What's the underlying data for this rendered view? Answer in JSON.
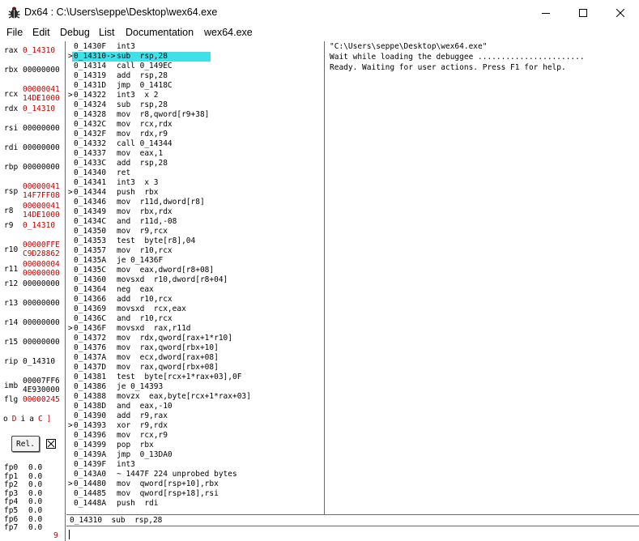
{
  "window": {
    "title": "Dx64 : C:\\Users\\seppe\\Desktop\\wex64.exe",
    "icons": [
      "bug-icon",
      "minimize-icon",
      "maximize-icon",
      "close-icon"
    ]
  },
  "menu": [
    "File",
    "Edit",
    "Debug",
    "List",
    "Documentation",
    "wex64.exe"
  ],
  "colors": {
    "changed": "#c00000",
    "highlight": "#40e0e8",
    "border": "#6a6a6a"
  },
  "registers": [
    {
      "name": "rax",
      "l1": "0_14310",
      "l2": "",
      "red": true
    },
    {
      "name": "rbx",
      "l1": "00000000",
      "l2": "",
      "red": false
    },
    {
      "name": "rcx",
      "l1": "00000041",
      "l2": "14DE1000",
      "red": true
    },
    {
      "name": "rdx",
      "l1": "0_14310",
      "l2": "",
      "red": true
    },
    {
      "name": "rsi",
      "l1": "00000000",
      "l2": "",
      "red": false
    },
    {
      "name": "rdi",
      "l1": "00000000",
      "l2": "",
      "red": false
    },
    {
      "name": "rbp",
      "l1": "00000000",
      "l2": "",
      "red": false
    },
    {
      "name": "rsp",
      "l1": "00000041",
      "l2": "14F7FF08",
      "red": true
    },
    {
      "name": "r8",
      "l1": "00000041",
      "l2": "14DE1000",
      "red": true
    },
    {
      "name": "r9",
      "l1": "0_14310",
      "l2": "",
      "red": true
    },
    {
      "name": "r10",
      "l1": "00000FFE",
      "l2": "C9D28862",
      "red": true
    },
    {
      "name": "r11",
      "l1": "00000004",
      "l2": "00000000",
      "red": true
    },
    {
      "name": "r12",
      "l1": "00000000",
      "l2": "",
      "red": false
    },
    {
      "name": "r13",
      "l1": "00000000",
      "l2": "",
      "red": false
    },
    {
      "name": "r14",
      "l1": "00000000",
      "l2": "",
      "red": false
    },
    {
      "name": "r15",
      "l1": "00000000",
      "l2": "",
      "red": false
    },
    {
      "name": "rip",
      "l1": "0_14310",
      "l2": "",
      "red": false
    },
    {
      "name": "imb",
      "l1": "00007FF6",
      "l2": "4E930000",
      "red": false
    },
    {
      "name": "flg",
      "l1": "00000245",
      "l2": "",
      "red": true
    }
  ],
  "flags": [
    {
      "t": "o",
      "red": false
    },
    {
      "t": "D",
      "red": true
    },
    {
      "t": "i",
      "red": false
    },
    {
      "t": "a",
      "red": false
    },
    {
      "t": "C",
      "red": true
    },
    {
      "t": "]",
      "red": true
    }
  ],
  "rel_button": "Rel.",
  "fpu": [
    {
      "name": "fp0",
      "val": "0.0"
    },
    {
      "name": "fp1",
      "val": "0.0"
    },
    {
      "name": "fp2",
      "val": "0.0"
    },
    {
      "name": "fp3",
      "val": "0.0"
    },
    {
      "name": "fp4",
      "val": "0.0"
    },
    {
      "name": "fp5",
      "val": "0.0"
    },
    {
      "name": "fp6",
      "val": "0.0"
    },
    {
      "name": "fp7",
      "val": "0.0"
    }
  ],
  "bottom_value": "9",
  "disassembly": [
    {
      "m": "",
      "a": "0_1430F",
      "i": "int3"
    },
    {
      "m": ">",
      "a": "0_14310->",
      "i": "sub  rsp,28",
      "current": true
    },
    {
      "m": "",
      "a": "0_14314",
      "i": "call 0_149EC"
    },
    {
      "m": "",
      "a": "0_14319",
      "i": "add  rsp,28"
    },
    {
      "m": "",
      "a": "0_1431D",
      "i": "jmp  0_1418C"
    },
    {
      "m": ">",
      "a": "0_14322",
      "i": "int3  x 2"
    },
    {
      "m": "",
      "a": "0_14324",
      "i": "sub  rsp,28"
    },
    {
      "m": "",
      "a": "0_14328",
      "i": "mov  r8,qword[r9+38]"
    },
    {
      "m": "",
      "a": "0_1432C",
      "i": "mov  rcx,rdx"
    },
    {
      "m": "",
      "a": "0_1432F",
      "i": "mov  rdx,r9"
    },
    {
      "m": "",
      "a": "0_14332",
      "i": "call 0_14344"
    },
    {
      "m": "",
      "a": "0_14337",
      "i": "mov  eax,1"
    },
    {
      "m": "",
      "a": "0_1433C",
      "i": "add  rsp,28"
    },
    {
      "m": "",
      "a": "0_14340",
      "i": "ret"
    },
    {
      "m": "",
      "a": "0_14341",
      "i": "int3  x 3"
    },
    {
      "m": ">",
      "a": "0_14344",
      "i": "push  rbx"
    },
    {
      "m": "",
      "a": "0_14346",
      "i": "mov  r11d,dword[r8]"
    },
    {
      "m": "",
      "a": "0_14349",
      "i": "mov  rbx,rdx"
    },
    {
      "m": "",
      "a": "0_1434C",
      "i": "and  r11d,-08"
    },
    {
      "m": "",
      "a": "0_14350",
      "i": "mov  r9,rcx"
    },
    {
      "m": "",
      "a": "0_14353",
      "i": "test  byte[r8],04"
    },
    {
      "m": "",
      "a": "0_14357",
      "i": "mov  r10,rcx"
    },
    {
      "m": "",
      "a": "0_1435A",
      "i": "je 0_1436F"
    },
    {
      "m": "",
      "a": "0_1435C",
      "i": "mov  eax,dword[r8+08]"
    },
    {
      "m": "",
      "a": "0_14360",
      "i": "movsxd  r10,dword[r8+04]"
    },
    {
      "m": "",
      "a": "0_14364",
      "i": "neg  eax"
    },
    {
      "m": "",
      "a": "0_14366",
      "i": "add  r10,rcx"
    },
    {
      "m": "",
      "a": "0_14369",
      "i": "movsxd  rcx,eax"
    },
    {
      "m": "",
      "a": "0_1436C",
      "i": "and  r10,rcx"
    },
    {
      "m": ">",
      "a": "0_1436F",
      "i": "movsxd  rax,r11d"
    },
    {
      "m": "",
      "a": "0_14372",
      "i": "mov  rdx,qword[rax+1*r10]"
    },
    {
      "m": "",
      "a": "0_14376",
      "i": "mov  rax,qword[rbx+10]"
    },
    {
      "m": "",
      "a": "0_1437A",
      "i": "mov  ecx,dword[rax+08]"
    },
    {
      "m": "",
      "a": "0_1437D",
      "i": "mov  rax,qword[rbx+08]"
    },
    {
      "m": "",
      "a": "0_14381",
      "i": "test  byte[rcx+1*rax+03],0F"
    },
    {
      "m": "",
      "a": "0_14386",
      "i": "je 0_14393"
    },
    {
      "m": "",
      "a": "0_14388",
      "i": "movzx  eax,byte[rcx+1*rax+03]"
    },
    {
      "m": "",
      "a": "0_1438D",
      "i": "and  eax,-10"
    },
    {
      "m": "",
      "a": "0_14390",
      "i": "add  r9,rax"
    },
    {
      "m": ">",
      "a": "0_14393",
      "i": "xor  r9,rdx"
    },
    {
      "m": "",
      "a": "0_14396",
      "i": "mov  rcx,r9"
    },
    {
      "m": "",
      "a": "0_14399",
      "i": "pop  rbx"
    },
    {
      "m": "",
      "a": "0_1439A",
      "i": "jmp  0_13DA0"
    },
    {
      "m": "",
      "a": "0_1439F",
      "i": "int3"
    },
    {
      "m": "",
      "a": "0_143A0",
      "i": "~ 1447F 224 unprobed bytes"
    },
    {
      "m": ">",
      "a": "0_14480",
      "i": "mov  qword[rsp+10],rbx"
    },
    {
      "m": "",
      "a": "0_14485",
      "i": "mov  qword[rsp+18],rsi"
    },
    {
      "m": "",
      "a": "0_1448A",
      "i": "push  rdi"
    }
  ],
  "console": [
    "\"C:\\Users\\seppe\\Desktop\\wex64.exe\"",
    "Wait while loading the debuggee .......................",
    "Ready. Waiting for user actions. Press F1 for help."
  ],
  "status_line": "0_14310  sub  rsp,28",
  "command_input": ""
}
